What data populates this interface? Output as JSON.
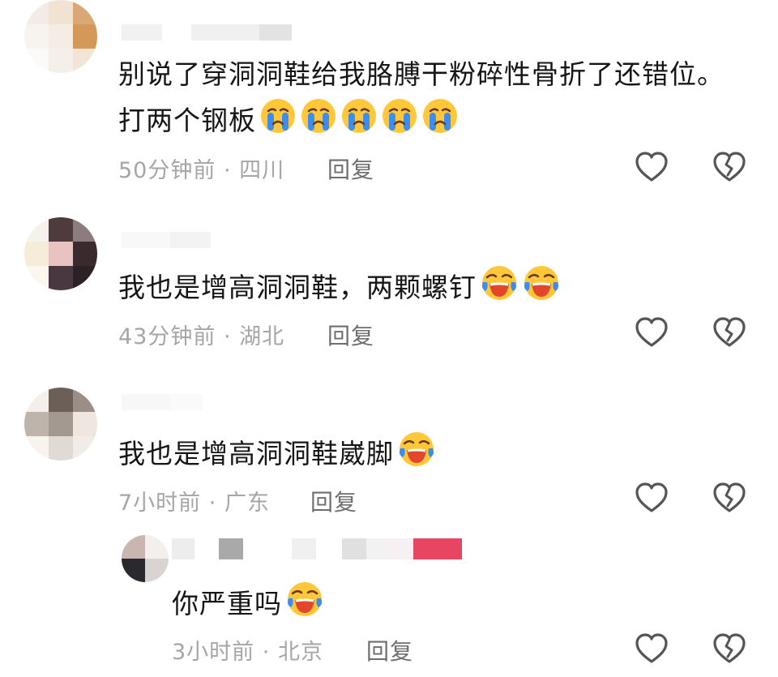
{
  "comments": [
    {
      "lines": [
        "别说了穿洞洞鞋给我胳膊干粉碎性骨折了还错位。",
        "打两个钢板"
      ],
      "emoji": "crying-face",
      "emoji_count": 5,
      "time": "50分钟前",
      "location": "四川",
      "reply_label": "回复"
    },
    {
      "lines": [
        "我也是增高洞洞鞋，两颗螺钉"
      ],
      "emoji": "laughing-crying-face",
      "emoji_count": 2,
      "time": "43分钟前",
      "location": "湖北",
      "reply_label": "回复"
    },
    {
      "lines": [
        "我也是增高洞洞鞋崴脚"
      ],
      "emoji": "laughing-crying-face",
      "emoji_count": 1,
      "time": "7小时前",
      "location": "广东",
      "reply_label": "回复"
    }
  ],
  "replies": [
    {
      "lines": [
        "你严重吗"
      ],
      "emoji": "laughing-crying-face",
      "emoji_count": 1,
      "time": "3小时前",
      "location": "北京",
      "reply_label": "回复"
    }
  ],
  "meta_separator": "·",
  "icons": {
    "like": "heart-outline-icon",
    "dislike": "broken-heart-icon"
  },
  "colors": {
    "meta_text": "#a6a6a6",
    "reply_text": "#6e6e6e",
    "emoji_face": "#ffc83a",
    "tears": "#3d8cf0",
    "mouth": "#e2462b"
  }
}
